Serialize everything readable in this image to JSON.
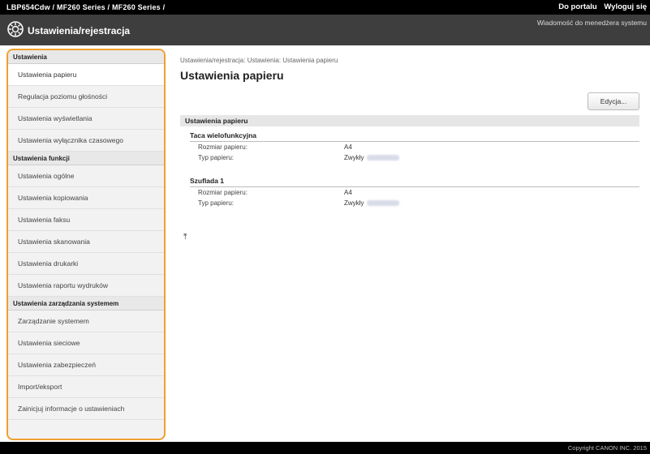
{
  "topbar": {
    "model": "LBP654Cdw  /  MF260 Series / MF260 Series /",
    "portal_label": "Do portalu",
    "logout_label": "Wyloguj się"
  },
  "titlebar": {
    "title": "Ustawienia/rejestracja",
    "message": "Wiadomość do menedżera systemu"
  },
  "sidebar": {
    "sections": [
      {
        "header": "Ustawienia",
        "items": [
          "Ustawienia papieru",
          "Regulacja poziomu głośności",
          "Ustawienia wyświetlania",
          "Ustawienia wyłącznika czasowego"
        ]
      },
      {
        "header": "Ustawienia funkcji",
        "items": [
          "Ustawienia ogólne",
          "Ustawienia kopiowania",
          "Ustawienia faksu",
          "Ustawienia skanowania",
          "Ustawienia drukarki",
          "Ustawienia raportu wydruków"
        ]
      },
      {
        "header": "Ustawienia zarządzania systemem",
        "items": [
          "Zarządzanie systemem",
          "Ustawienia sieciowe",
          "Ustawienia zabezpieczeń",
          "Import/eksport",
          "Zainicjuj informacje o ustawieniach"
        ]
      }
    ],
    "active": "Ustawienia papieru"
  },
  "main": {
    "breadcrumb": "Ustawienia/rejestracja: Ustawienia: Ustawienia papieru",
    "title": "Ustawienia papieru",
    "edit_label": "Edycja...",
    "section_title": "Ustawienia papieru",
    "groups": [
      {
        "title": "Taca wielofunkcyjna",
        "rows": [
          {
            "key": "Rozmiar papieru:",
            "value": "A4"
          },
          {
            "key": "Typ papieru:",
            "value": "Zwykły"
          }
        ]
      },
      {
        "title": "Szuflada 1",
        "rows": [
          {
            "key": "Rozmiar papieru:",
            "value": "A4"
          },
          {
            "key": "Typ papieru:",
            "value": "Zwykły"
          }
        ]
      }
    ],
    "to_top_icon": "arrow-up-to-top-icon"
  },
  "footer": {
    "copyright": "Copyright CANON INC. 2015"
  },
  "colors": {
    "highlight_border": "#f0a030",
    "titlebar_bg": "#3e3e3e"
  }
}
